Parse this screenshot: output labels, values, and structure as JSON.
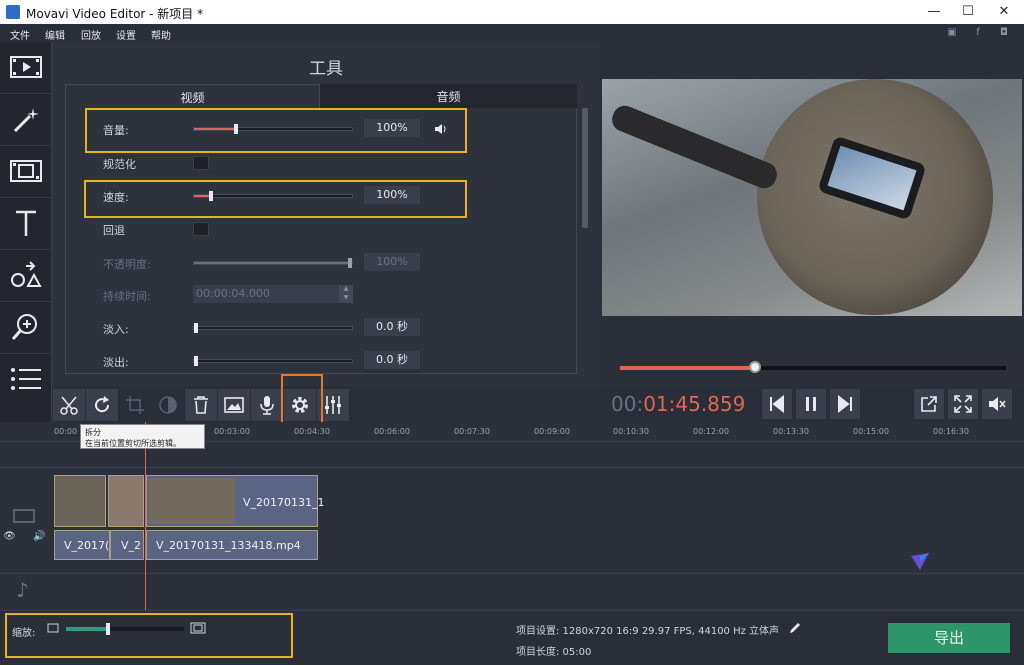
{
  "window": {
    "title": "Movavi Video Editor - 新项目 *",
    "min": "—",
    "max": "☐",
    "close": "✕"
  },
  "menu": [
    "文件",
    "编辑",
    "回放",
    "设置",
    "帮助"
  ],
  "panel": {
    "title": "工具",
    "tabs": [
      "视频",
      "音频"
    ],
    "rows": [
      {
        "label": "音量:",
        "value": "100%",
        "fill": 0.26
      },
      {
        "label": "规范化"
      },
      {
        "label": "速度:",
        "value": "100%",
        "fill": 0.1
      },
      {
        "label": "回退"
      },
      {
        "label": "不透明度:",
        "value": "100%",
        "fill": 1.0
      },
      {
        "label": "持续时间:",
        "value": "00:00:04.000"
      },
      {
        "label": "淡入:",
        "value": "0.0 秒",
        "fill": 0.0
      },
      {
        "label": "淡出:",
        "value": "0.0 秒",
        "fill": 0.0
      }
    ]
  },
  "player": {
    "time_dim": "00:",
    "time_red": "01:45.859",
    "progress": 0.35
  },
  "timeline": {
    "ticks": [
      "00:00",
      "00:03:00",
      "00:04:30",
      "00:06:00",
      "00:07:30",
      "00:09:00",
      "00:10:30",
      "00:12:00",
      "00:13:30",
      "00:15:00",
      "00:16:30"
    ],
    "clips_video": [
      "V_20170131_1"
    ],
    "clips_audio": [
      "V_2017(",
      "V_2",
      "V_20170131_133418.mp4"
    ]
  },
  "tooltip": {
    "title": "拆分",
    "text": "在当前位置剪切所选剪辑。"
  },
  "bottom": {
    "zoom_label": "缩放:",
    "zoom_level": 0.36,
    "settings": "项目设置:  1280x720 16:9 29.97 FPS, 44100 Hz 立体声",
    "length": "项目长度:  05:00",
    "export": "导出"
  },
  "colors": {
    "accent": "#e06552",
    "export": "#2e9469",
    "highlight": "#e3b21c"
  }
}
